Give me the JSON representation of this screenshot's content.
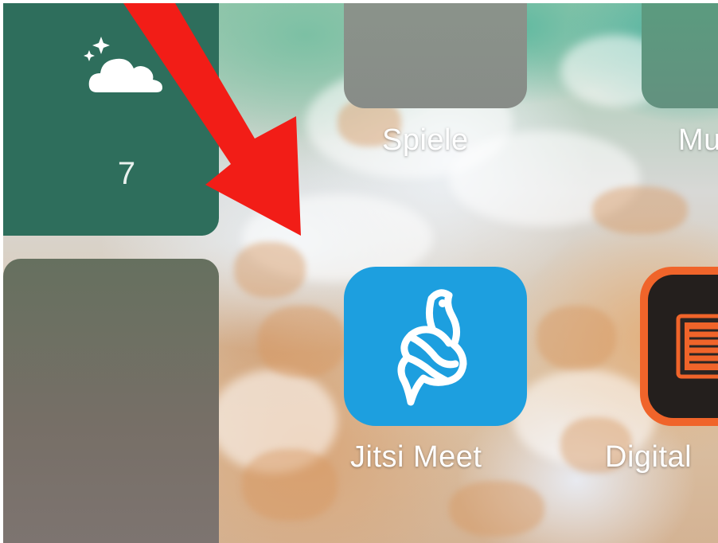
{
  "weather_widget": {
    "icon": "cloud-with-stars-icon",
    "temperature": "7"
  },
  "folders": [
    {
      "label": "Spiele"
    },
    {
      "label": "Mu"
    }
  ],
  "apps": [
    {
      "label": "Jitsi Meet",
      "icon": "jitsi-meet-bird-icon",
      "color": "#1d9fdf"
    },
    {
      "label": "Digital",
      "icon": "digital-editions-icon",
      "color": "#f0642a"
    }
  ],
  "annotation": {
    "icon": "red-arrow-icon",
    "color": "#f21d17"
  }
}
